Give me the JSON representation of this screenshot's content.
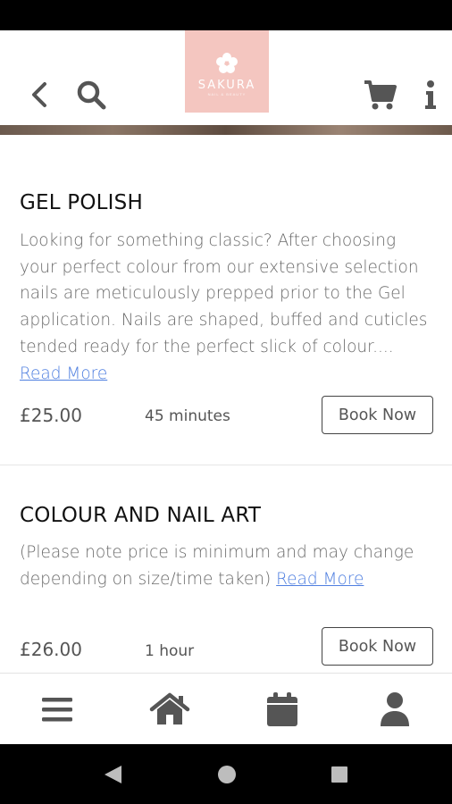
{
  "header": {
    "logo_text": "SAKURA",
    "logo_subtext": "NAIL & BEAUTY"
  },
  "services": [
    {
      "title": "GEL POLISH",
      "description": "Looking for something classic? After choosing your perfect colour from our extensive selection nails are meticulously prepped prior to the Gel application. Nails are shaped, buffed and cuticles tended ready for the perfect slick of colour....",
      "read_more": "Read More",
      "price": "£25.00",
      "duration": "45 minutes",
      "book_label": "Book Now"
    },
    {
      "title": "COLOUR AND NAIL ART",
      "description": "(Please note price is minimum and may change depending on size/time taken)",
      "read_more": "Read More",
      "price": "£26.00",
      "duration": "1 hour",
      "book_label": "Book Now"
    }
  ],
  "icons": {
    "back": "chevron-left-icon",
    "search": "search-icon",
    "cart": "cart-icon",
    "info": "info-icon",
    "menu": "menu-icon",
    "home": "home-icon",
    "calendar": "calendar-icon",
    "user": "user-icon"
  },
  "colors": {
    "logo_bg": "#f4c6c0",
    "link": "#4f7fe0",
    "icon": "#555555"
  }
}
